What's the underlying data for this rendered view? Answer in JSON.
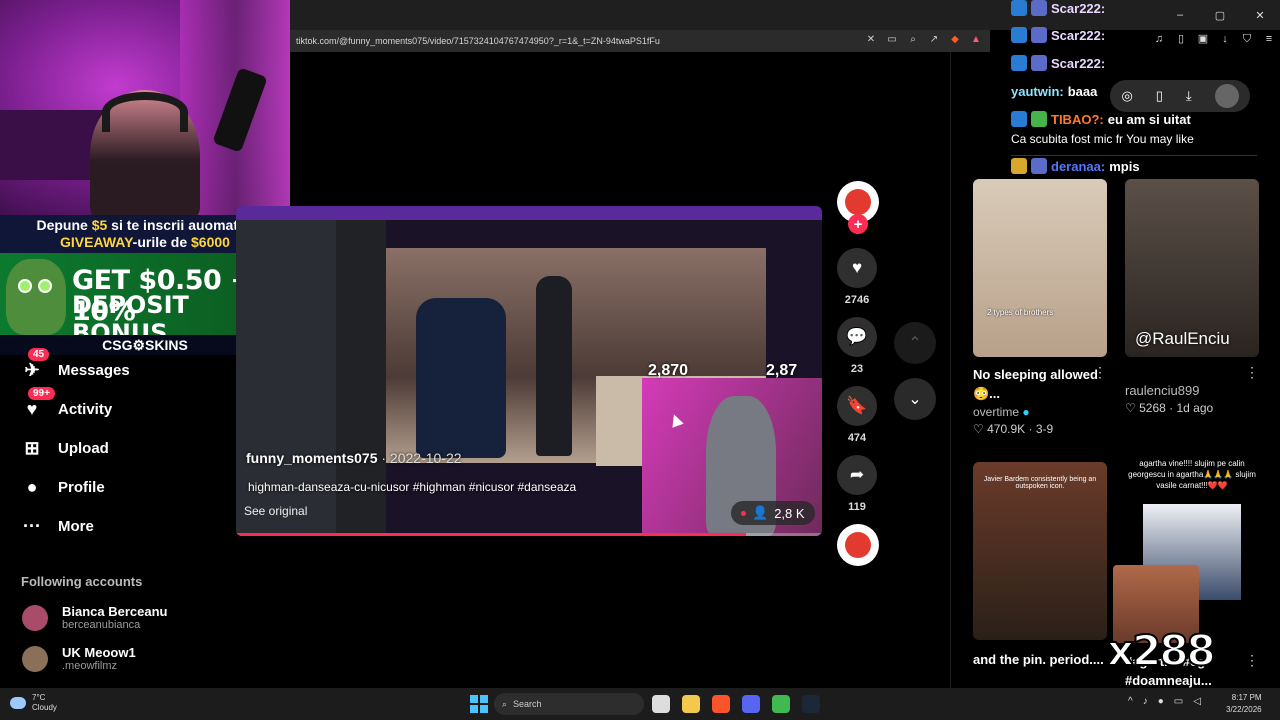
{
  "browser": {
    "url": "tiktok.com/@funny_moments075/video/7157324104767474950?_r=1&_t=ZN-94twaPS1fFu",
    "window_controls": [
      "–",
      "▢",
      "✕"
    ]
  },
  "stream_overlay": {
    "promo_line1_a": "Depune ",
    "promo_line1_amount": "$5",
    "promo_line1_b": " si te inscrii auomat la",
    "promo_line2_a": "GIVEAWAY",
    "promo_line2_b": "-urile de ",
    "promo_line2_amount": "$6000",
    "bonus_line1": "GET $0.50 + 10%",
    "bonus_line2": "DEPOSIT BONUS",
    "brand": "CSG⚙SKINS"
  },
  "nav": {
    "items": [
      {
        "label": "Messages",
        "badge": "45",
        "icon": "✈"
      },
      {
        "label": "Activity",
        "badge": "99+",
        "icon": "♥"
      },
      {
        "label": "Upload",
        "icon": "⊞"
      },
      {
        "label": "Profile",
        "icon": "●"
      },
      {
        "label": "More",
        "icon": "···"
      }
    ],
    "following_title": "Following accounts",
    "accounts": [
      {
        "name": "Bianca Berceanu",
        "handle": "berceanubianca"
      },
      {
        "name": "UK Meoow1",
        "handle": ".meowfilmz"
      }
    ]
  },
  "video": {
    "author": "funny_moments075",
    "date": " · 2022-10-22",
    "caption": "highman-danseaza-cu-nicusor #highman #nicusor #danseaza",
    "see_original": "See original",
    "overlay_stat1": "2,870",
    "overlay_stat2": "2,87",
    "viewer_count": "2,8 K",
    "progress": 0.87
  },
  "actions": {
    "likes": "2746",
    "comments": "23",
    "saves": "474",
    "shares": "119"
  },
  "chat": [
    {
      "name": "Scar222:",
      "msg": ""
    },
    {
      "name": "Scar222:",
      "msg": ""
    },
    {
      "name": "Scar222:",
      "msg": ""
    },
    {
      "name": "yautwin:",
      "msg": "baaa"
    },
    {
      "name": "TIBAO?:",
      "msg": "eu am si uitat"
    },
    {
      "name": "",
      "msg": "Ca scubita fost mic fr You may like"
    },
    {
      "name": "deranaa:",
      "msg": "mpis"
    }
  ],
  "right_panel": {
    "you_may_like": "You may like",
    "cards": [
      {
        "title": "No sleeping allowed 😳...",
        "author": "overtime",
        "likes": "470.9K",
        "extra": "3-9",
        "thumb_text": "2 types of brothers"
      },
      {
        "title": "",
        "author": "raulenciu899",
        "likes": "5268",
        "extra": "1d ago",
        "thumb_text": "@RaulEnciu"
      },
      {
        "title": "and the pin. period....",
        "author": "",
        "likes": "",
        "extra": "",
        "thumb_text": "Javier Bardem consistently being an outspoken icon."
      },
      {
        "title": "#agartha #cg #doamneaju...",
        "author": "",
        "likes": "",
        "extra": "",
        "thumb_text": "agartha vine!!!! slujim pe calin georgescu in agartha🙏🙏🙏 slujim vasile carnat!!!❤️❤️"
      }
    ],
    "x_counter": "x288"
  },
  "taskbar": {
    "temp": "7°C",
    "weather": "Cloudy",
    "search": "Search",
    "time": "8:17 PM",
    "date": "3/22/2026"
  }
}
